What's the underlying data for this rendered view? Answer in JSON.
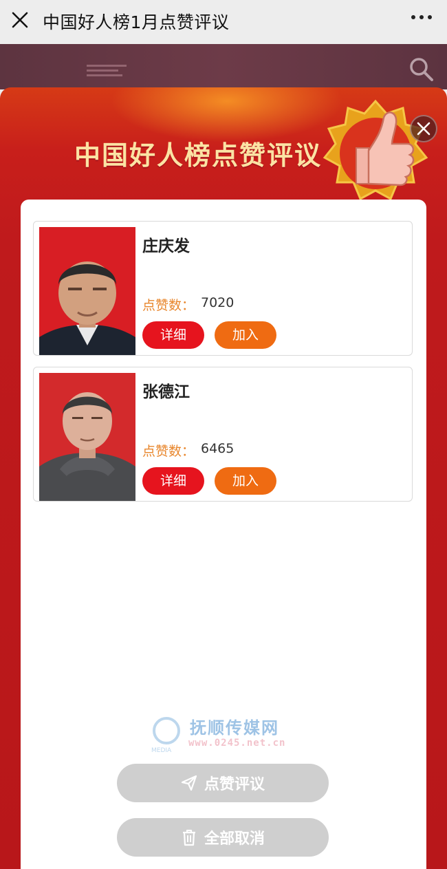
{
  "topbar": {
    "title": "中国好人榜1月点赞评议"
  },
  "modal": {
    "banner_title": "中国好人榜点赞评议"
  },
  "candidates": [
    {
      "name": "庄庆发",
      "likes_label": "点赞数：",
      "likes": "7020",
      "detail_label": "详细",
      "join_label": "加入"
    },
    {
      "name": "张德江",
      "likes_label": "点赞数：",
      "likes": "6465",
      "detail_label": "详细",
      "join_label": "加入"
    }
  ],
  "watermark": {
    "name": "抚顺传媒网",
    "url": "www.0245.net.cn",
    "media": "MEDIA"
  },
  "actions": {
    "vote_label": "点赞评议",
    "cancel_all_label": "全部取消"
  },
  "colors": {
    "modal_red": "#bf1a1c",
    "detail_button": "#e6141e",
    "join_button": "#ef6b12",
    "likes_label": "#e8862c",
    "disabled_button": "#cfcfcf"
  }
}
